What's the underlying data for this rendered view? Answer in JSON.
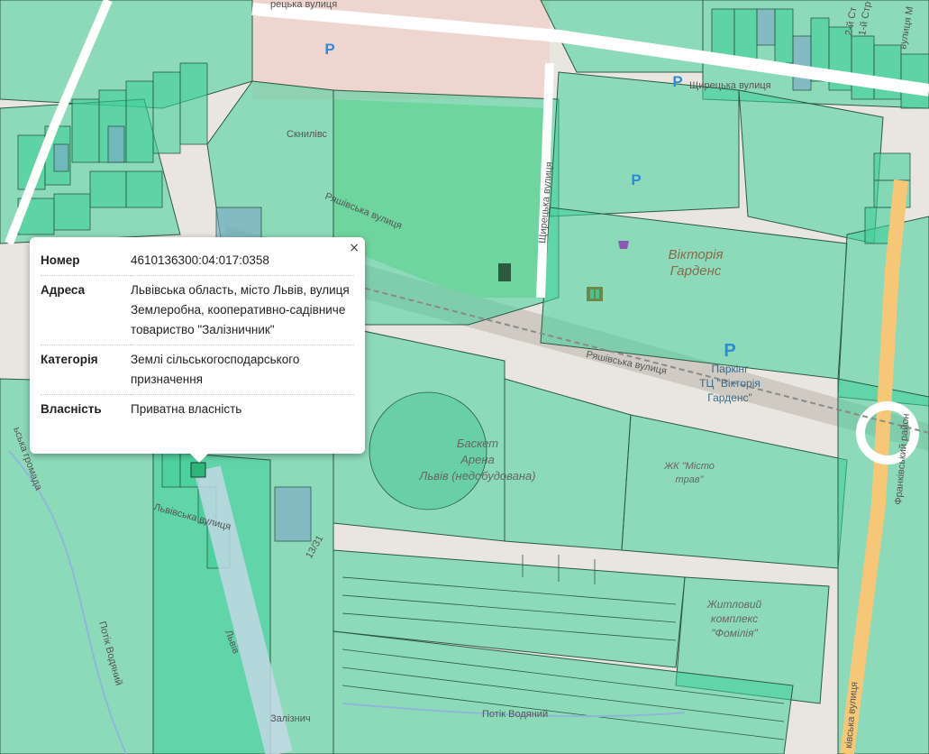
{
  "map": {
    "street_labels": {
      "skrynivska": "Скнилівс",
      "shyretska_top": "Щирецька вулиця",
      "shyretska_vert": "Щирецька вулиця",
      "riashivska_1": "Ряшівська вулиця",
      "riashivska_2": "Ряшівська вулиця",
      "franka_vert": "Франківський район",
      "kulparkivska": "ківська вулиця",
      "lvivska": "Львівська вулиця",
      "potik_vodianyi_1": "Потік Водяний",
      "potik_vodianyi_2": "Потік Водяний",
      "zaliznychna": "Залізнич",
      "lviv_small": "Львів",
      "road_num": "13/31",
      "top_left_street": "рецька вулиця",
      "lvivska_hromada": "ьська громада",
      "top_right_1": "1-й Стр",
      "top_right_2": "2-й Ст",
      "top_right_3": "вулиця М"
    },
    "poi_labels": {
      "victoria_gardens_1": "Вікторія",
      "victoria_gardens_2": "Гарденс",
      "parking_1": "Паркінг",
      "parking_2": "ТЦ \"Вікторія",
      "parking_3": "Гарденс\"",
      "basket_1": "Баскет",
      "basket_2": "Арена",
      "basket_3": "Львів (недобудована)",
      "zhk_1": "ЖК \"Місто",
      "zhk_2": "трав\"",
      "complex_1": "Житловий",
      "complex_2": "комплекс",
      "complex_3": "\"Фомілія\""
    },
    "parking_symbol": "P",
    "colors": {
      "parcel_fill": "#3fcf9a",
      "parcel_stroke": "#2b5a40",
      "base_bg": "#e9e6df",
      "park_green": "#a9dba5",
      "residential": "#e4dad0",
      "road_yellow": "#f5c777",
      "railway": "#c0bcb2",
      "blue_parcel": "#7fa6c9"
    }
  },
  "popup": {
    "close": "×",
    "rows": [
      {
        "key": "Номер",
        "value": "4610136300:04:017:0358"
      },
      {
        "key": "Адреса",
        "value": "Львівська область, місто Львів, вулиця Землеробна, кооперативно-садівниче товариство \"Залізничник\""
      },
      {
        "key": "Категорія",
        "value": "Землі сільськогосподарського призначення"
      },
      {
        "key": "Власність",
        "value": "Приватна власність"
      }
    ]
  }
}
